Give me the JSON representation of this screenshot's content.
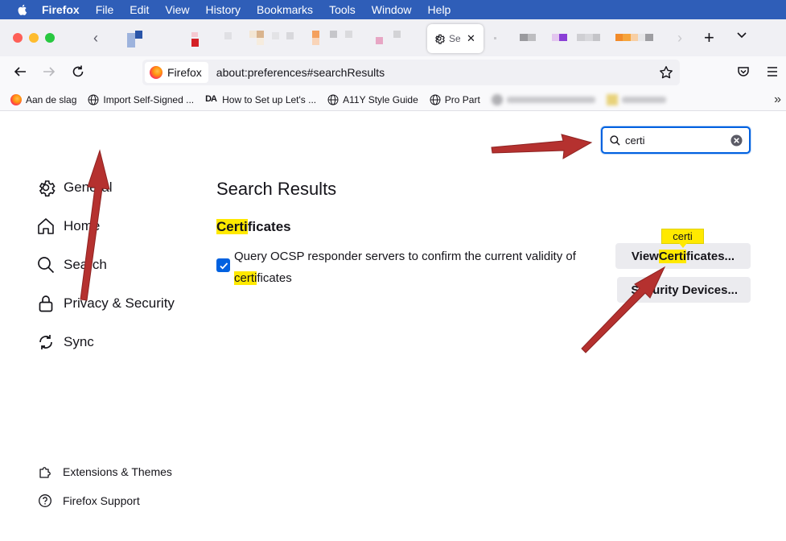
{
  "menubar": {
    "app": "Firefox",
    "items": [
      "File",
      "Edit",
      "View",
      "History",
      "Bookmarks",
      "Tools",
      "Window",
      "Help"
    ]
  },
  "tabs": {
    "active_label": "Settings"
  },
  "navbar": {
    "identity_label": "Firefox",
    "url": "about:preferences#searchResults"
  },
  "bookmarks": [
    {
      "label": "Aan de slag",
      "icon": "firefox-icon"
    },
    {
      "label": "Import Self-Signed ...",
      "icon": "globe-icon"
    },
    {
      "label": "How to Set up Let's ...",
      "icon": "da-icon"
    },
    {
      "label": "A11Y Style Guide",
      "icon": "globe-icon"
    },
    {
      "label": "Pro Part",
      "icon": "globe-icon"
    }
  ],
  "search": {
    "value": "certi"
  },
  "sidebar": {
    "items": [
      {
        "label": "General",
        "icon": "gear-icon"
      },
      {
        "label": "Home",
        "icon": "home-icon"
      },
      {
        "label": "Search",
        "icon": "search-icon"
      },
      {
        "label": "Privacy & Security",
        "icon": "lock-icon"
      },
      {
        "label": "Sync",
        "icon": "sync-icon"
      }
    ],
    "footer": [
      {
        "label": "Extensions & Themes",
        "icon": "puzzle-icon"
      },
      {
        "label": "Firefox Support",
        "icon": "help-icon"
      }
    ]
  },
  "main": {
    "results_title": "Search Results",
    "section": {
      "highlight": "Certi",
      "rest": "ficates"
    },
    "ocsp": {
      "text": "Query OCSP responder servers to confirm the current validity of ",
      "highlight": "certi",
      "rest": "ficates",
      "checked": true
    },
    "view_button": {
      "prefix": "View ",
      "highlight": "Certi",
      "rest": "ficates..."
    },
    "security_button": {
      "label": "Security Devices..."
    },
    "tooltip": "certi"
  },
  "colors": {
    "accent": "#0061e0",
    "highlight": "#ffe900",
    "arrow": "#b5312f",
    "menubar": "#2f5eb8"
  }
}
